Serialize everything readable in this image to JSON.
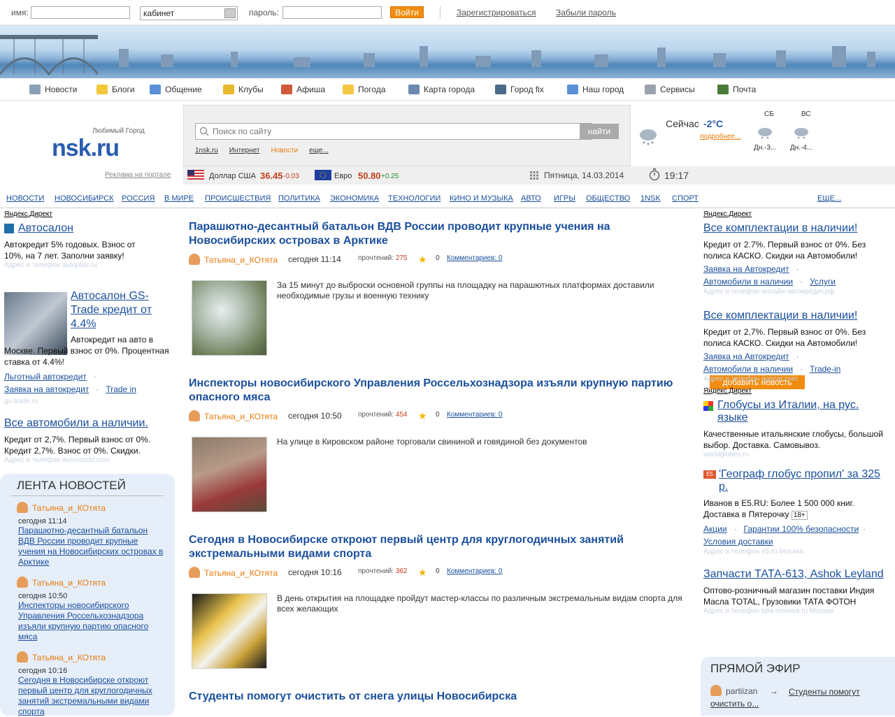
{
  "login": {
    "name_label": "имя:",
    "cabinet_value": "кабинет",
    "password_label": "пароль:",
    "login_button": "Войти",
    "register_link": "Зарегистрироваться",
    "forgot_link": "Забыли пароль"
  },
  "main_nav": [
    {
      "label": "Новости",
      "icon": "newspaper-icon"
    },
    {
      "label": "Блоги",
      "icon": "pencil-icon"
    },
    {
      "label": "Общение",
      "icon": "chat-icon"
    },
    {
      "label": "Клубы",
      "icon": "trophy-icon"
    },
    {
      "label": "Афиша",
      "icon": "megaphone-icon"
    },
    {
      "label": "Погода",
      "icon": "sun-cloud-icon"
    },
    {
      "label": "Карта города",
      "icon": "map-icon"
    },
    {
      "label": "Город fix",
      "icon": "tools-icon"
    },
    {
      "label": "Наш город",
      "icon": "city-icon"
    },
    {
      "label": "Сервисы",
      "icon": "bell-icon"
    },
    {
      "label": "Почта",
      "icon": "book-icon"
    }
  ],
  "logo": {
    "tagline": "Любимый Город",
    "name": "nsk.ru"
  },
  "portal_ads_link": "Реклама на портале",
  "search": {
    "placeholder": "Поиск по сайту",
    "button": "найти",
    "scopes": [
      "1nsk.ru",
      "Интернет",
      "Новости",
      "еще..."
    ],
    "active_scope": "Новости"
  },
  "weather": {
    "now_label": "Сейчас",
    "now_temp": "-2°C",
    "more_link": "подробнее...",
    "forecast": [
      {
        "day": "СБ",
        "temp": "Дн.-3..."
      },
      {
        "day": "ВС",
        "temp": "Дн.-4..."
      }
    ]
  },
  "currency": {
    "usd": {
      "label": "Доллар США",
      "value": "36.45",
      "change": "-0.03"
    },
    "eur": {
      "label": "Евро",
      "value": "50.80",
      "change": "+0.25"
    },
    "date": "Пятница, 14.03.2014",
    "time": "19:17"
  },
  "topics": [
    "НОВОСТИ",
    "НОВОСИБИРСК",
    "РОССИЯ",
    "В МИРЕ",
    "ПРОИСШЕСТВИЯ",
    "ПОЛИТИКА",
    "ЭКОНОМИКА",
    "ТЕХНОЛОГИИ",
    "КИНО И МУЗЫКА",
    "АВТО",
    "ИГРЫ",
    "ОБЩЕСТВО",
    "1NSK",
    "СПОРТ"
  ],
  "add_news_button": "добавить новость",
  "topics_more": "ЕЩЕ...",
  "left_ads": {
    "label": "Яндекс.Директ",
    "ad1": {
      "title": "Автосалон",
      "text": "Автокредит 5% годовых. Взнос от 10%, на 7 лет. Заполни заявку!",
      "url": "Адрес и телефон autoplus.ru"
    },
    "ad2": {
      "title": "Автосалон GS-Trade кредит от 4.4%",
      "text": "Автокредит на авто в Москве. Первый взнос от 0%. Процентная ставка от 4.4%!",
      "links": [
        "Льготный автокредит",
        "Заявка на автокредит",
        "Trade in"
      ],
      "url": "gs-trade.ru"
    },
    "ad3": {
      "title": "Все автомобили а наличии.",
      "text": "Кредит от 2,7%. Первый взнос от 0%. Кредит 2,7%. Взнос от 0%. Скидки.",
      "url": "Адрес и телефон autovocdd.com"
    }
  },
  "feed": {
    "title": "ЛЕНТА НОВОСТЕЙ",
    "items": [
      {
        "author": "Татьяна_и_КОтята",
        "time": "сегодня  11:14",
        "title": "Парашютно-десантный батальон ВДВ России проводит крупные учения на Новосибирских островах в Арктике"
      },
      {
        "author": "Татьяна_и_КОтята",
        "time": "сегодня  10:50",
        "title": "Инспекторы новосибирского Управления Россельхознадзора изъяли крупную партию опасного мяса"
      },
      {
        "author": "Татьяна_и_КОтята",
        "time": "сегодня  10:16",
        "title": "Сегодня в Новосибирске откроют первый центр для круглогодичных занятий экстремальными видами спорта"
      }
    ]
  },
  "articles": [
    {
      "title": "Парашютно-десантный батальон ВДВ России проводит крупные учения на Новосибирских островах в Арктике",
      "author": "Татьяна_и_КОтята",
      "time": "сегодня 11:14",
      "reads_label": "прочтений:",
      "reads": "275",
      "rating": "0",
      "comments": "Комментариев: 0",
      "lead": "За 15 минут до выброски основной группы на площадку на парашютных платформах доставили необходимые грузы и военную технику"
    },
    {
      "title": "Инспекторы новосибирского Управления Россельхознадзора изъяли крупную партию опасного мяса",
      "author": "Татьяна_и_КОтята",
      "time": "сегодня 10:50",
      "reads_label": "прочтений:",
      "reads": "454",
      "rating": "0",
      "comments": "Комментариев: 0",
      "lead": "На улице в Кировском районе торговали свининой и говядиной без документов"
    },
    {
      "title": "Сегодня в Новосибирске откроют первый центр для круглогодичных занятий экстремальными видами спорта",
      "author": "Татьяна_и_КОтята",
      "time": "сегодня 10:16",
      "reads_label": "прочтений:",
      "reads": "362",
      "rating": "0",
      "comments": "Комментариев: 0",
      "lead": "В день открытия на площадке пройдут мастер-классы по различным экстремальным видам спорта для всех желающих"
    },
    {
      "title": "Студенты помогут очистить от снега улицы Новосибирска"
    }
  ],
  "right_ads": {
    "label1": "Яндекс.Директ",
    "ad1": {
      "title": "Все комплектации в наличии!",
      "text": "Кредит от 2.7%. Первый взнос от 0%. Без полиса КАСКО. Скидки на Автомобили!",
      "links": [
        "Заявка на Автокредит",
        "Автомобили в наличии",
        "Услуги"
      ],
      "url": "Адрес и телефон онлайн-автокредит.рф"
    },
    "ad2": {
      "title": "Все комплектации в наличии!",
      "text": "Кредит от 2,7%. Первый взнос от 0%. Без полиса КАСКО. Скидки на Автомобили!",
      "links": [
        "Заявка на Автокредит",
        "Автомобили в наличии",
        "Trade-in"
      ],
      "url": "Адрес и телефон agecar.com"
    },
    "label2": "Яндекс.Директ",
    "ad3": {
      "title": "Глобусы из Италии, на рус. языке",
      "text": "Качественные итальянские глобусы, большой выбор. Доставка. Самовывоз.",
      "url": "worldglobes.ru"
    },
    "ad4": {
      "title": "'Географ глобус пропил' за 325 р.",
      "text": "Иванов в E5.RU: Более 1 500 000 книг. Доставка в Пятерочку",
      "age": "18+",
      "links": [
        "Акции",
        "Гарантии 100% безопасности",
        "Условия доставки"
      ],
      "url": "Адрес и телефон e5.ru Москва"
    },
    "ad5": {
      "title": "Запчасти ТАТА-613, Ashok Leyland",
      "text": "Оптово-розничный магазин поставки Индия Масла TOTAL, Грузовики ТАТА ФОТОН",
      "url": "Адрес и телефон tata-moskva.ru Москва"
    }
  },
  "live": {
    "title": "ПРЯМОЙ ЭФИР",
    "user": "partiizan",
    "arrow": "→",
    "link": "Студенты помогут очистить о..."
  },
  "colors": {
    "accent": "#f28c0f",
    "link": "#1a4f9c",
    "author": "#e77b0b",
    "feed_bg": "#e6eef9"
  }
}
